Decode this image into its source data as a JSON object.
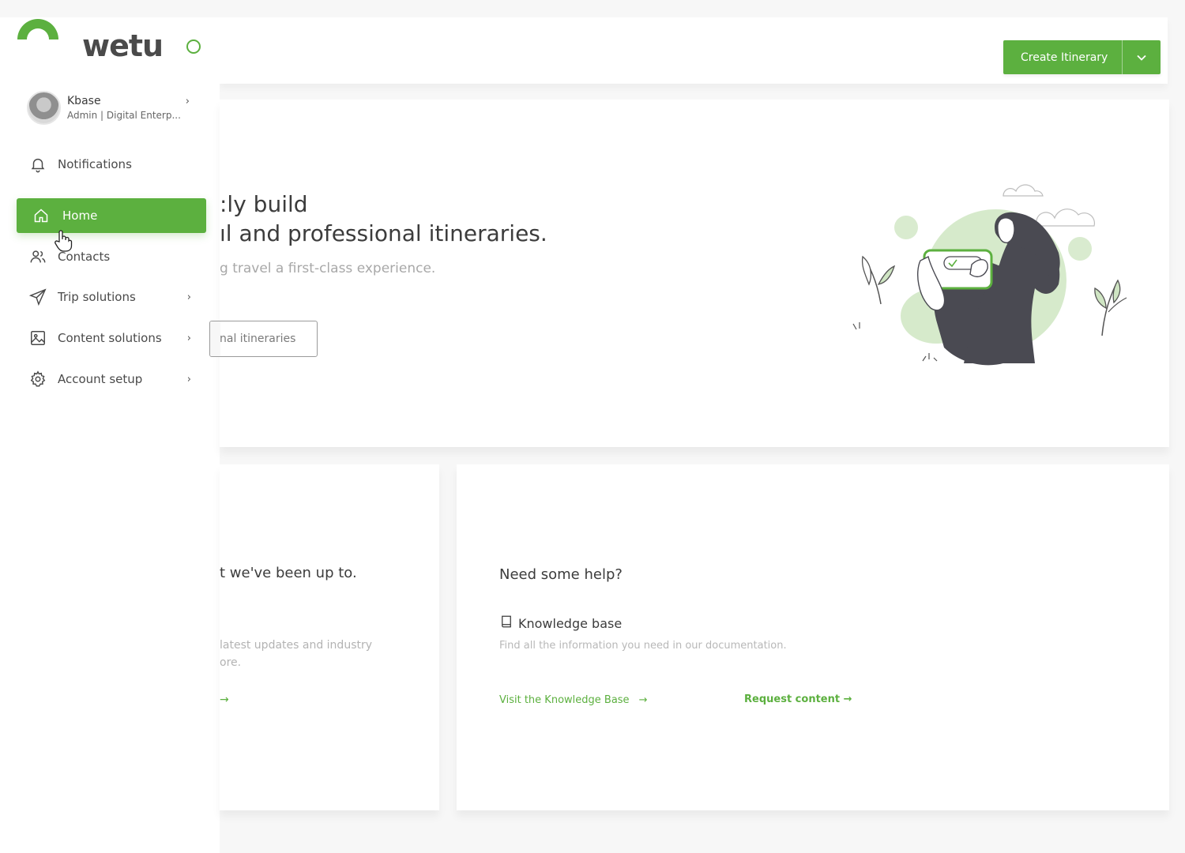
{
  "brand": {
    "name": "wetu",
    "accent": "#5cb03f"
  },
  "header": {
    "create_label": "Create Itinerary"
  },
  "profile": {
    "name": "Kbase",
    "role": "Admin | Digital Enterp..."
  },
  "sidebar": {
    "items": [
      {
        "label": "Notifications",
        "icon": "bell-icon"
      },
      {
        "label": "Home",
        "icon": "home-icon"
      },
      {
        "label": "Contacts",
        "icon": "users-icon"
      },
      {
        "label": "Trip solutions",
        "icon": "paper-plane-icon"
      },
      {
        "label": "Content solutions",
        "icon": "image-icon"
      },
      {
        "label": "Account setup",
        "icon": "gear-icon"
      }
    ]
  },
  "hero": {
    "title_line1": ":ly build",
    "title_line2": "ıl and professional itineraries.",
    "subtitle": "g travel a first-class experience.",
    "button_label": "nal itineraries"
  },
  "news": {
    "title": "t we've been up to.",
    "body": "latest updates and industry ore.",
    "arrow": "→"
  },
  "help": {
    "title": "Need some help?",
    "kb_label": "Knowledge base",
    "kb_description": "Find all the information you need in our documentation.",
    "visit_link": "Visit the Knowledge Base",
    "visit_arrow": "→",
    "request_link": "Request content →"
  }
}
